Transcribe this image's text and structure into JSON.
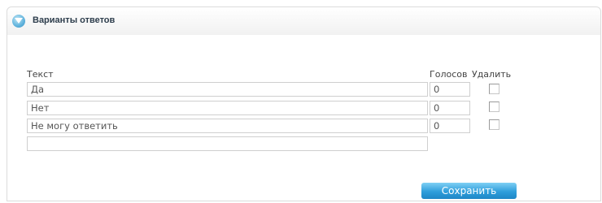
{
  "panel": {
    "title": "Варианты ответов"
  },
  "table": {
    "col_text": "Текст",
    "col_votes": "Голосов",
    "col_delete": "Удалить",
    "rows": [
      {
        "text": "Да",
        "votes": "0",
        "delete": false
      },
      {
        "text": "Нет",
        "votes": "0",
        "delete": false
      },
      {
        "text": "Не могу ответить",
        "votes": "0",
        "delete": false
      }
    ],
    "new_row": {
      "text": ""
    }
  },
  "save_label": "Сохранить",
  "colors": {
    "button": "#2f9edb",
    "title": "#2d3d4c"
  }
}
